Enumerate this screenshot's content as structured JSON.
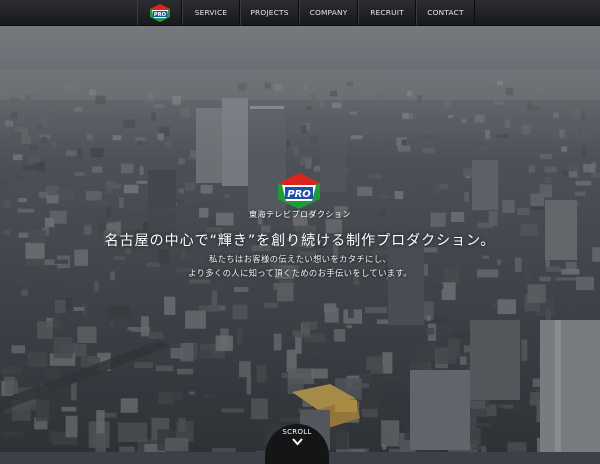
{
  "nav": {
    "logo_text": "PRO",
    "items": [
      {
        "label": "SERVICE"
      },
      {
        "label": "PROJECTS"
      },
      {
        "label": "COMPANY"
      },
      {
        "label": "RECRUIT"
      },
      {
        "label": "CONTACT"
      }
    ]
  },
  "hero": {
    "logo_text": "PRO",
    "company_name": "東海テレビプロダクション",
    "tagline": "名古屋の中心で“輝き”を創り続ける制作プロダクション。",
    "sub_lines": [
      "私たちはお客様の伝えたい想いをカタチにし、",
      "より多くの人に知って頂くためのお手伝いをしています。"
    ]
  },
  "scroll": {
    "label": "SCROLL"
  },
  "colors": {
    "logo_blue": "#1e4fa8",
    "logo_red": "#d9251d",
    "logo_green": "#1f9a3c",
    "nav_text": "#e6e6e6",
    "scroll_bg": "#141517"
  }
}
